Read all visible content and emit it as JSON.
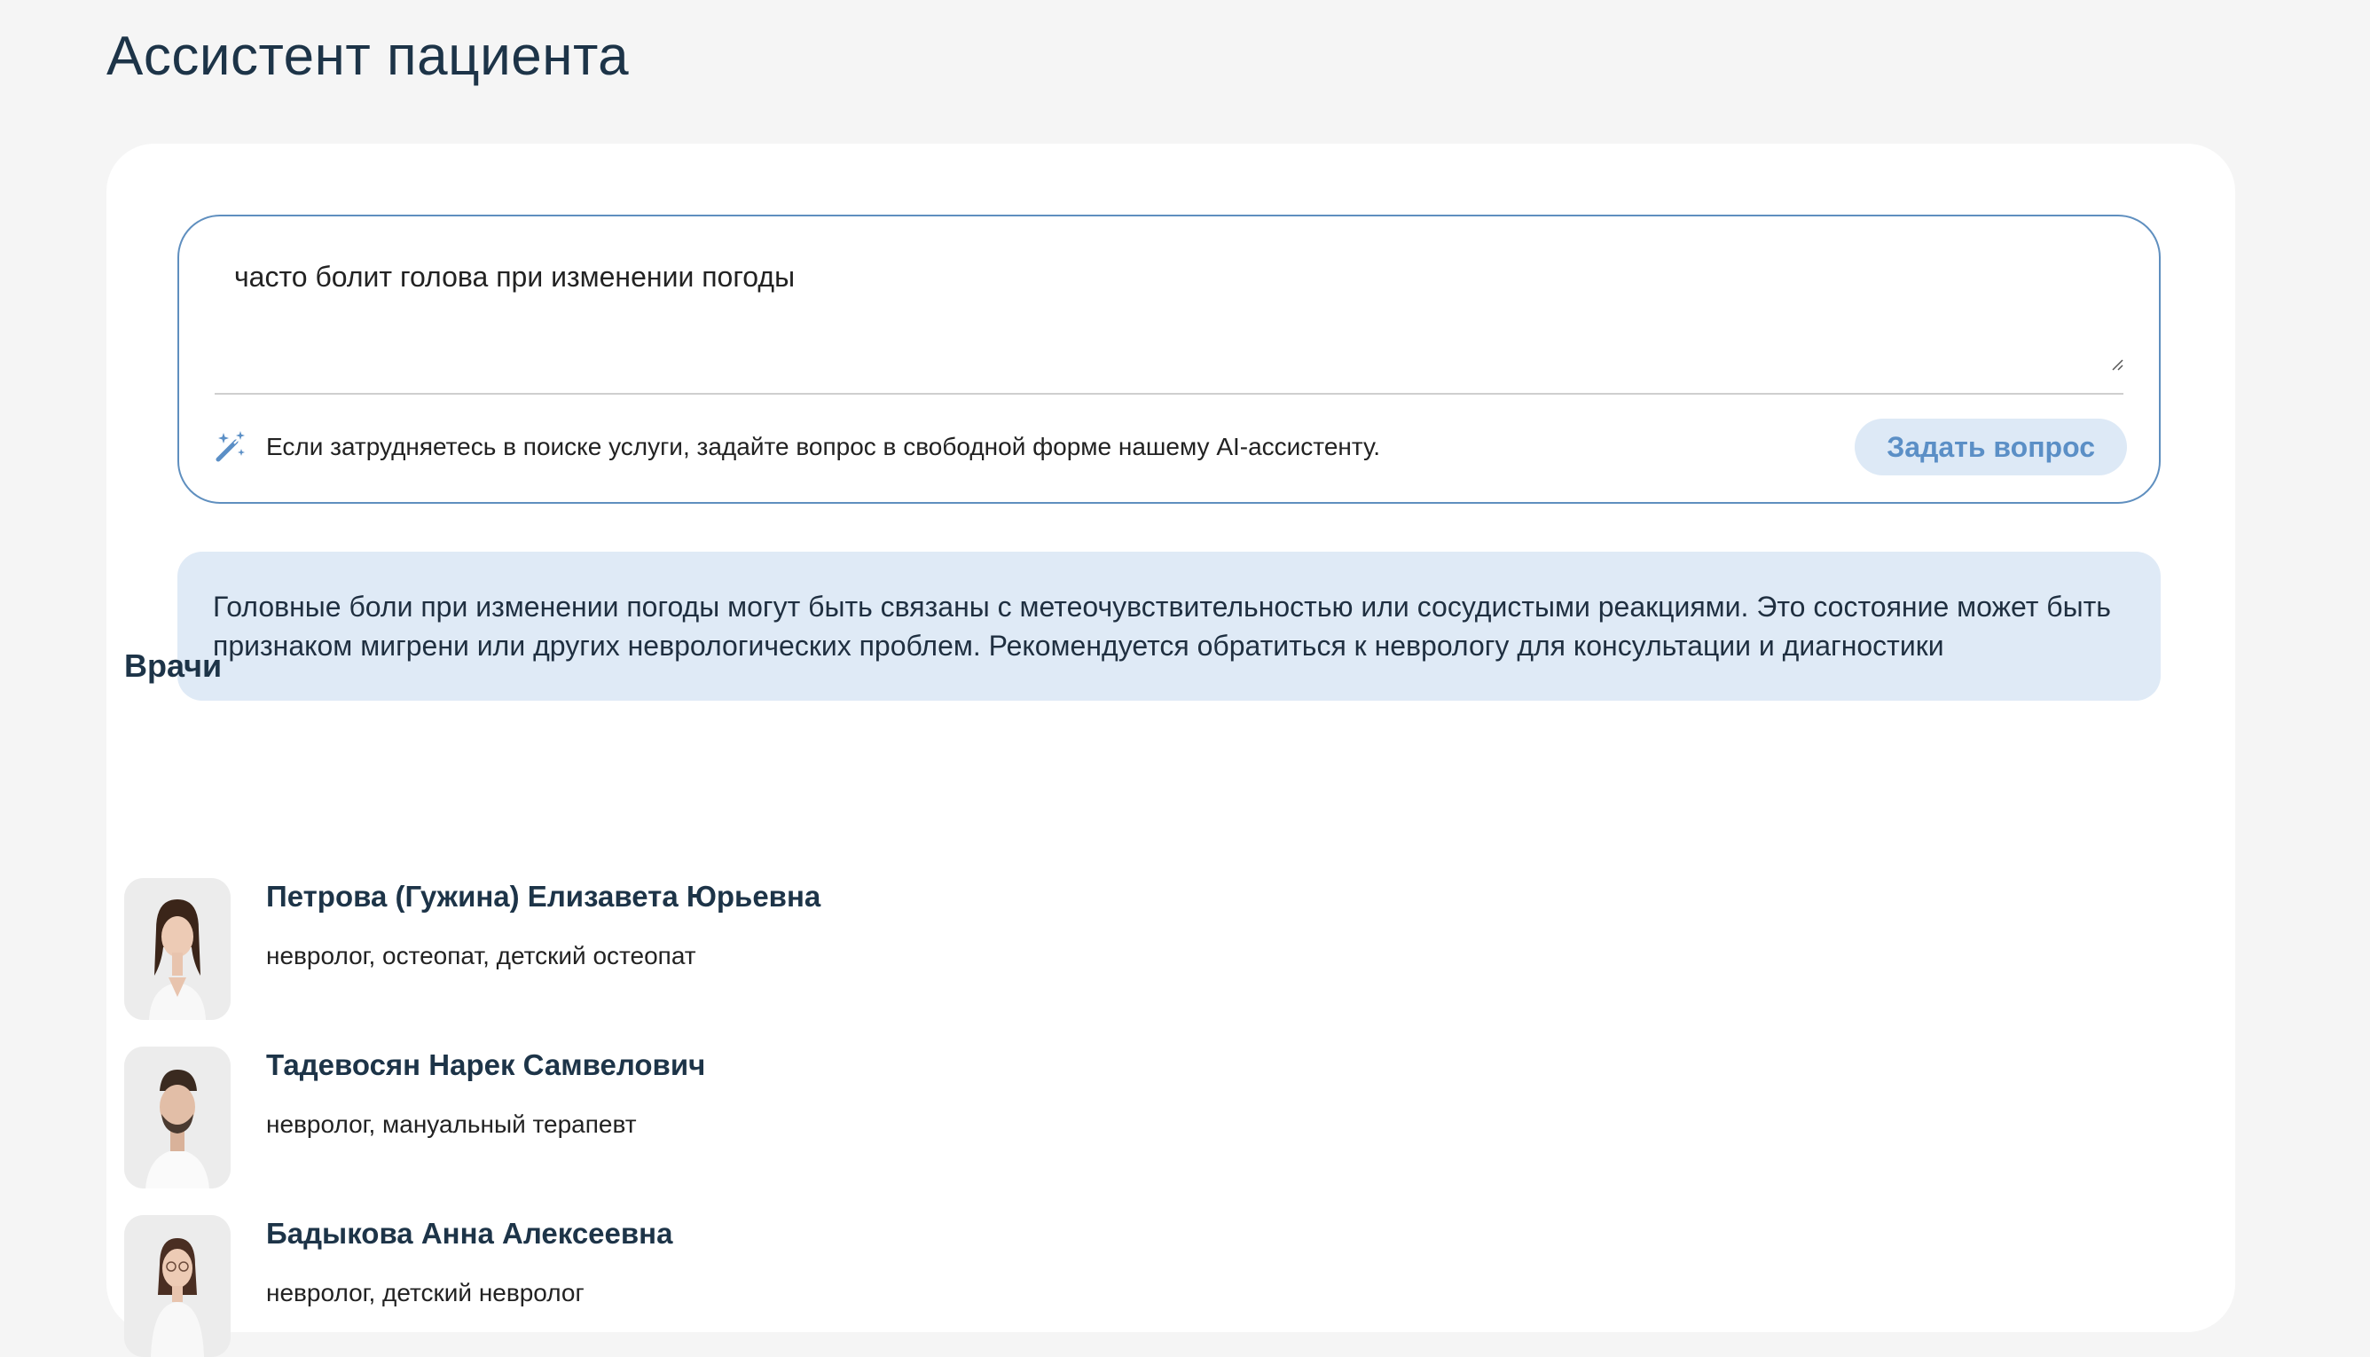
{
  "header": {
    "title": "Ассистент пациента"
  },
  "assistant": {
    "question_value": "часто болит голова при изменении погоды",
    "hint": "Если затрудняетесь в поиске услуги, задайте вопрос в свободной форме нашему AI-ассистенту.",
    "ask_button": "Задать вопрос",
    "accent_color": "#5b8fc6",
    "answer": "Головные боли при изменении погоды могут быть связаны с метеочувствительностью или сосудистыми реакциями. Это состояние может быть признаком мигрени или других неврологических проблем. Рекомендуется обратиться к неврологу для консультации и диагностики"
  },
  "doctors": {
    "title": "Врачи",
    "items": [
      {
        "name": "Петрова (Гужина) Елизавета Юрьевна",
        "specialty": "невролог, остеопат, детский остеопат"
      },
      {
        "name": "Тадевосян Нарек Самвелович",
        "specialty": "невролог, мануальный терапевт"
      },
      {
        "name": "Бадыкова Анна Алексеевна",
        "specialty": "невролог, детский невролог"
      }
    ]
  }
}
